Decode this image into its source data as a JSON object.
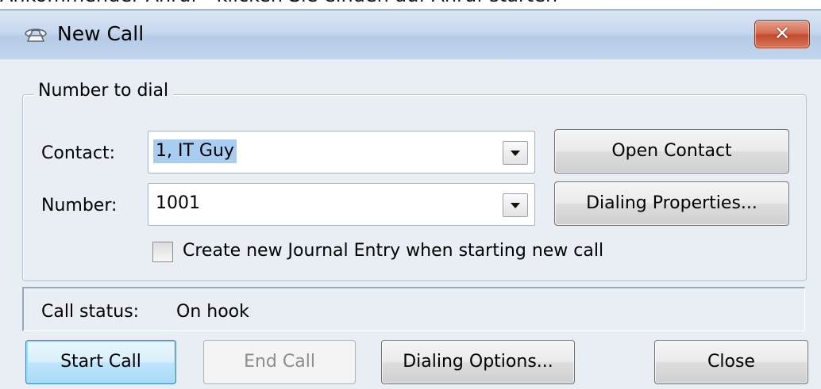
{
  "background_caption": "Ankommender Anruf - klicken Sie einden auf Anruf starten",
  "window": {
    "title": "New Call",
    "title_icon": "phone-icon",
    "close_symbol": "✕"
  },
  "group": {
    "title": "Number to dial",
    "contact_label": "Contact:",
    "contact_value": "1, IT Guy",
    "number_label": "Number:",
    "number_value": "1001",
    "open_contact_label": "Open Contact",
    "dialing_properties_label": "Dialing Properties...",
    "journal_checkbox_label": "Create new Journal Entry when starting new call",
    "journal_checked": false
  },
  "status": {
    "label": "Call status:",
    "value": "On hook"
  },
  "buttons": {
    "start_call": "Start Call",
    "end_call": "End Call",
    "dialing_options": "Dialing Options...",
    "close": "Close"
  },
  "colors": {
    "title_gradient_top": "#dbe7f5",
    "close_button": "#c24a2c",
    "selection_highlight": "#a8cdf0",
    "default_button": "#bee6fd"
  }
}
